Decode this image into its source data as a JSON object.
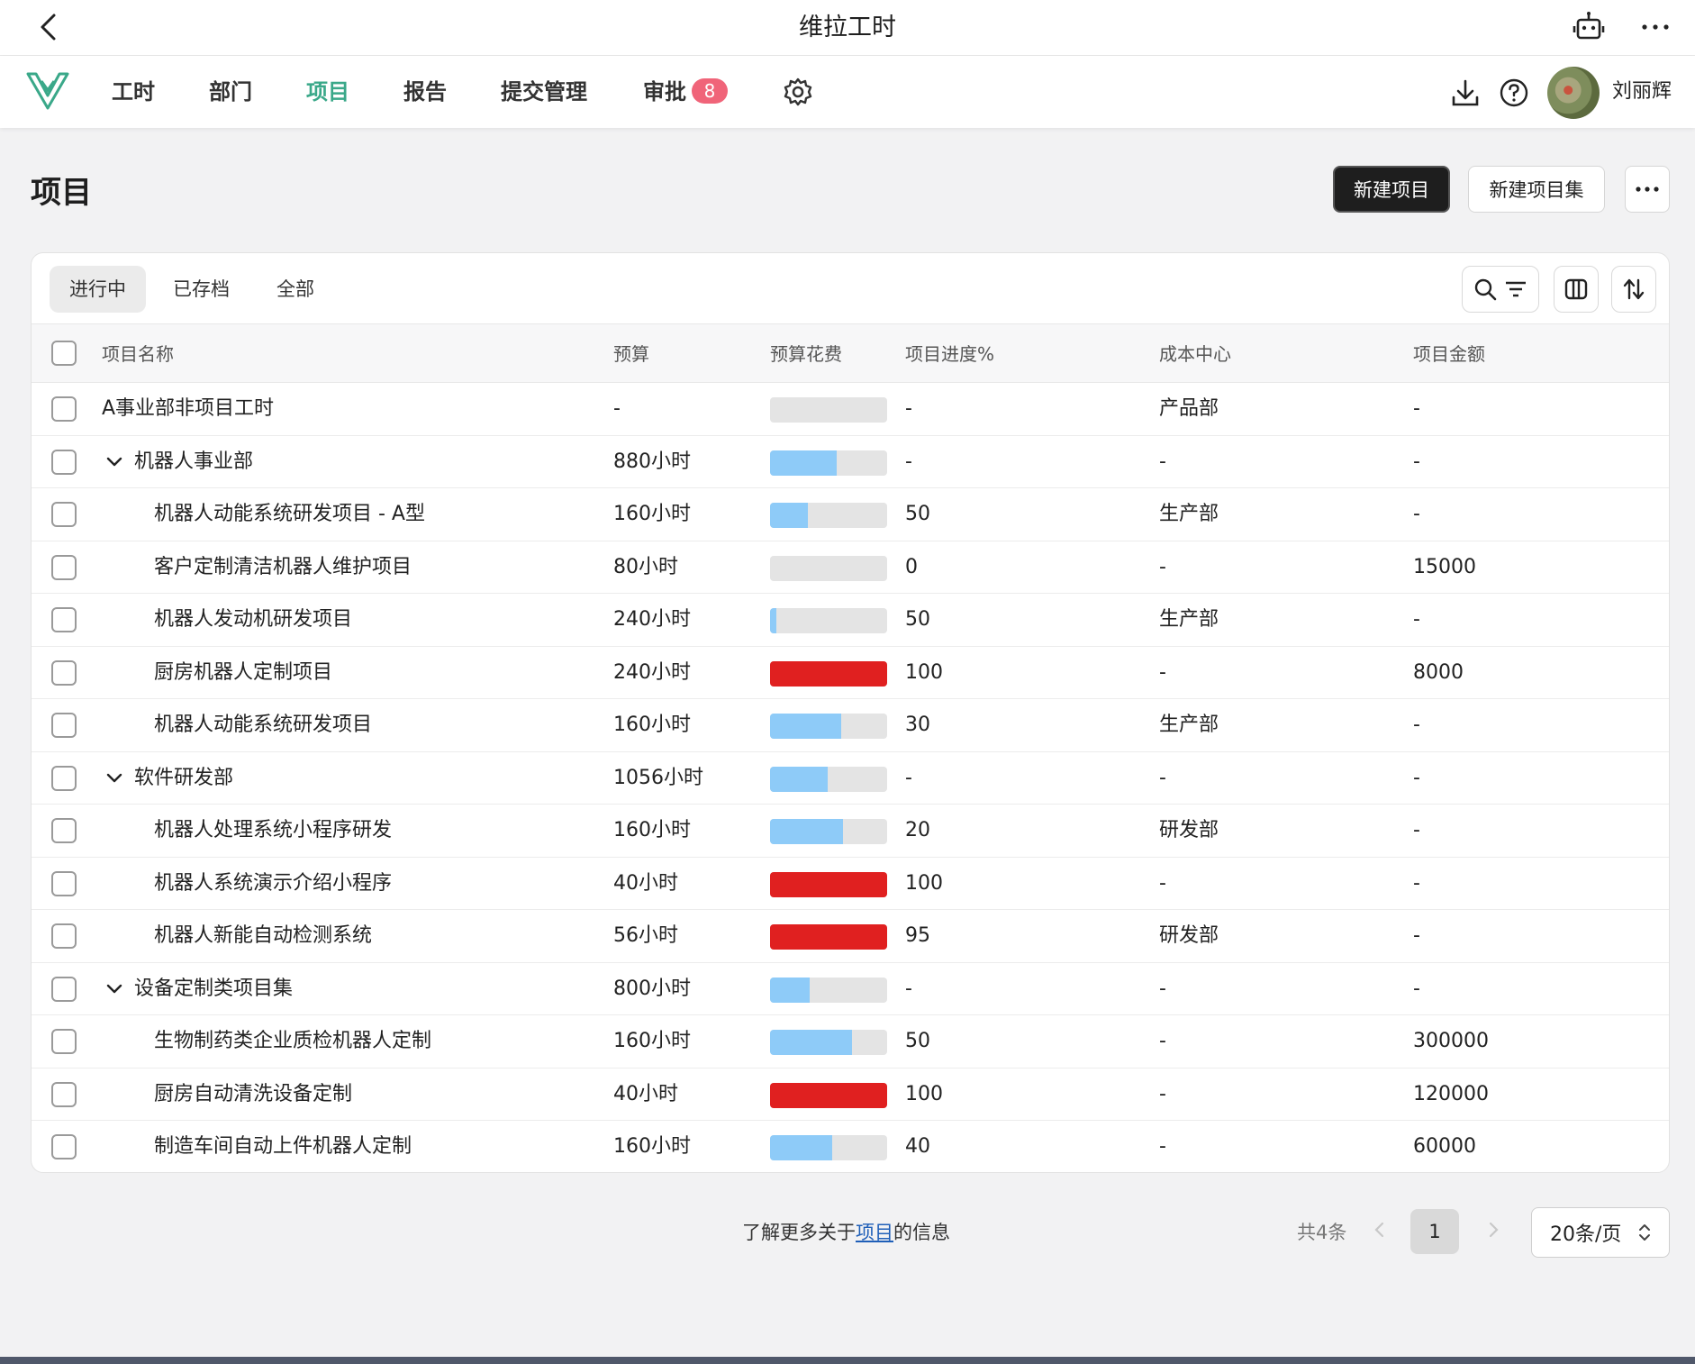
{
  "app": {
    "title": "维拉工时"
  },
  "nav": {
    "items": [
      {
        "label": "工时",
        "active": false
      },
      {
        "label": "部门",
        "active": false
      },
      {
        "label": "项目",
        "active": true
      },
      {
        "label": "报告",
        "active": false
      },
      {
        "label": "提交管理",
        "active": false
      },
      {
        "label": "审批",
        "active": false,
        "badge": "8"
      }
    ],
    "user": "刘丽辉"
  },
  "page": {
    "title": "项目",
    "new_project": "新建项目",
    "new_project_set": "新建项目集"
  },
  "tabs": [
    "进行中",
    "已存档",
    "全部"
  ],
  "table": {
    "headers": [
      "项目名称",
      "预算",
      "预算花费",
      "项目进度%",
      "成本中心",
      "项目金额"
    ],
    "rows": [
      {
        "name": "A事业部非项目工时",
        "budget": "-",
        "spent": 0,
        "over": false,
        "progress": "-",
        "cost_center": "产品部",
        "amount": "-",
        "level": 0,
        "group": false
      },
      {
        "name": "机器人事业部",
        "budget": "880小时",
        "spent": 0.57,
        "over": false,
        "progress": "-",
        "cost_center": "-",
        "amount": "-",
        "level": 0,
        "group": true
      },
      {
        "name": "机器人动能系统研发项目 - A型",
        "budget": "160小时",
        "spent": 0.32,
        "over": false,
        "progress": "50",
        "cost_center": "生产部",
        "amount": "-",
        "level": 1,
        "group": false
      },
      {
        "name": "客户定制清洁机器人维护项目",
        "budget": "80小时",
        "spent": 0,
        "over": false,
        "progress": "0",
        "cost_center": "-",
        "amount": "15000",
        "level": 1,
        "group": false
      },
      {
        "name": "机器人发动机研发项目",
        "budget": "240小时",
        "spent": 0.05,
        "over": false,
        "progress": "50",
        "cost_center": "生产部",
        "amount": "-",
        "level": 1,
        "group": false
      },
      {
        "name": "厨房机器人定制项目",
        "budget": "240小时",
        "spent": 1,
        "over": true,
        "progress": "100",
        "cost_center": "-",
        "amount": "8000",
        "level": 1,
        "group": false
      },
      {
        "name": "机器人动能系统研发项目",
        "budget": "160小时",
        "spent": 0.61,
        "over": false,
        "progress": "30",
        "cost_center": "生产部",
        "amount": "-",
        "level": 1,
        "group": false
      },
      {
        "name": "软件研发部",
        "budget": "1056小时",
        "spent": 0.49,
        "over": false,
        "progress": "-",
        "cost_center": "-",
        "amount": "-",
        "level": 0,
        "group": true
      },
      {
        "name": "机器人处理系统小程序研发",
        "budget": "160小时",
        "spent": 0.62,
        "over": false,
        "progress": "20",
        "cost_center": "研发部",
        "amount": "-",
        "level": 1,
        "group": false
      },
      {
        "name": "机器人系统演示介绍小程序",
        "budget": "40小时",
        "spent": 1,
        "over": true,
        "progress": "100",
        "cost_center": "-",
        "amount": "-",
        "level": 1,
        "group": false
      },
      {
        "name": "机器人新能自动检测系统",
        "budget": "56小时",
        "spent": 1,
        "over": true,
        "progress": "95",
        "cost_center": "研发部",
        "amount": "-",
        "level": 1,
        "group": false
      },
      {
        "name": "设备定制类项目集",
        "budget": "800小时",
        "spent": 0.34,
        "over": false,
        "progress": "-",
        "cost_center": "-",
        "amount": "-",
        "level": 0,
        "group": true
      },
      {
        "name": "生物制药类企业质检机器人定制",
        "budget": "160小时",
        "spent": 0.7,
        "over": false,
        "progress": "50",
        "cost_center": "-",
        "amount": "300000",
        "level": 1,
        "group": false
      },
      {
        "name": "厨房自动清洗设备定制",
        "budget": "40小时",
        "spent": 1,
        "over": true,
        "progress": "100",
        "cost_center": "-",
        "amount": "120000",
        "level": 1,
        "group": false
      },
      {
        "name": "制造车间自动上件机器人定制",
        "budget": "160小时",
        "spent": 0.53,
        "over": false,
        "progress": "40",
        "cost_center": "-",
        "amount": "60000",
        "level": 1,
        "group": false
      }
    ]
  },
  "footer": {
    "learn_prefix": "了解更多关于",
    "learn_link": "项目",
    "learn_suffix": "的信息",
    "total": "共4条",
    "current_page": "1",
    "page_size": "20条/页"
  },
  "colors": {
    "accent": "#3aa889",
    "bar_fill": "#8ecbf8",
    "bar_over": "#e02020",
    "badge": "#f06479"
  }
}
